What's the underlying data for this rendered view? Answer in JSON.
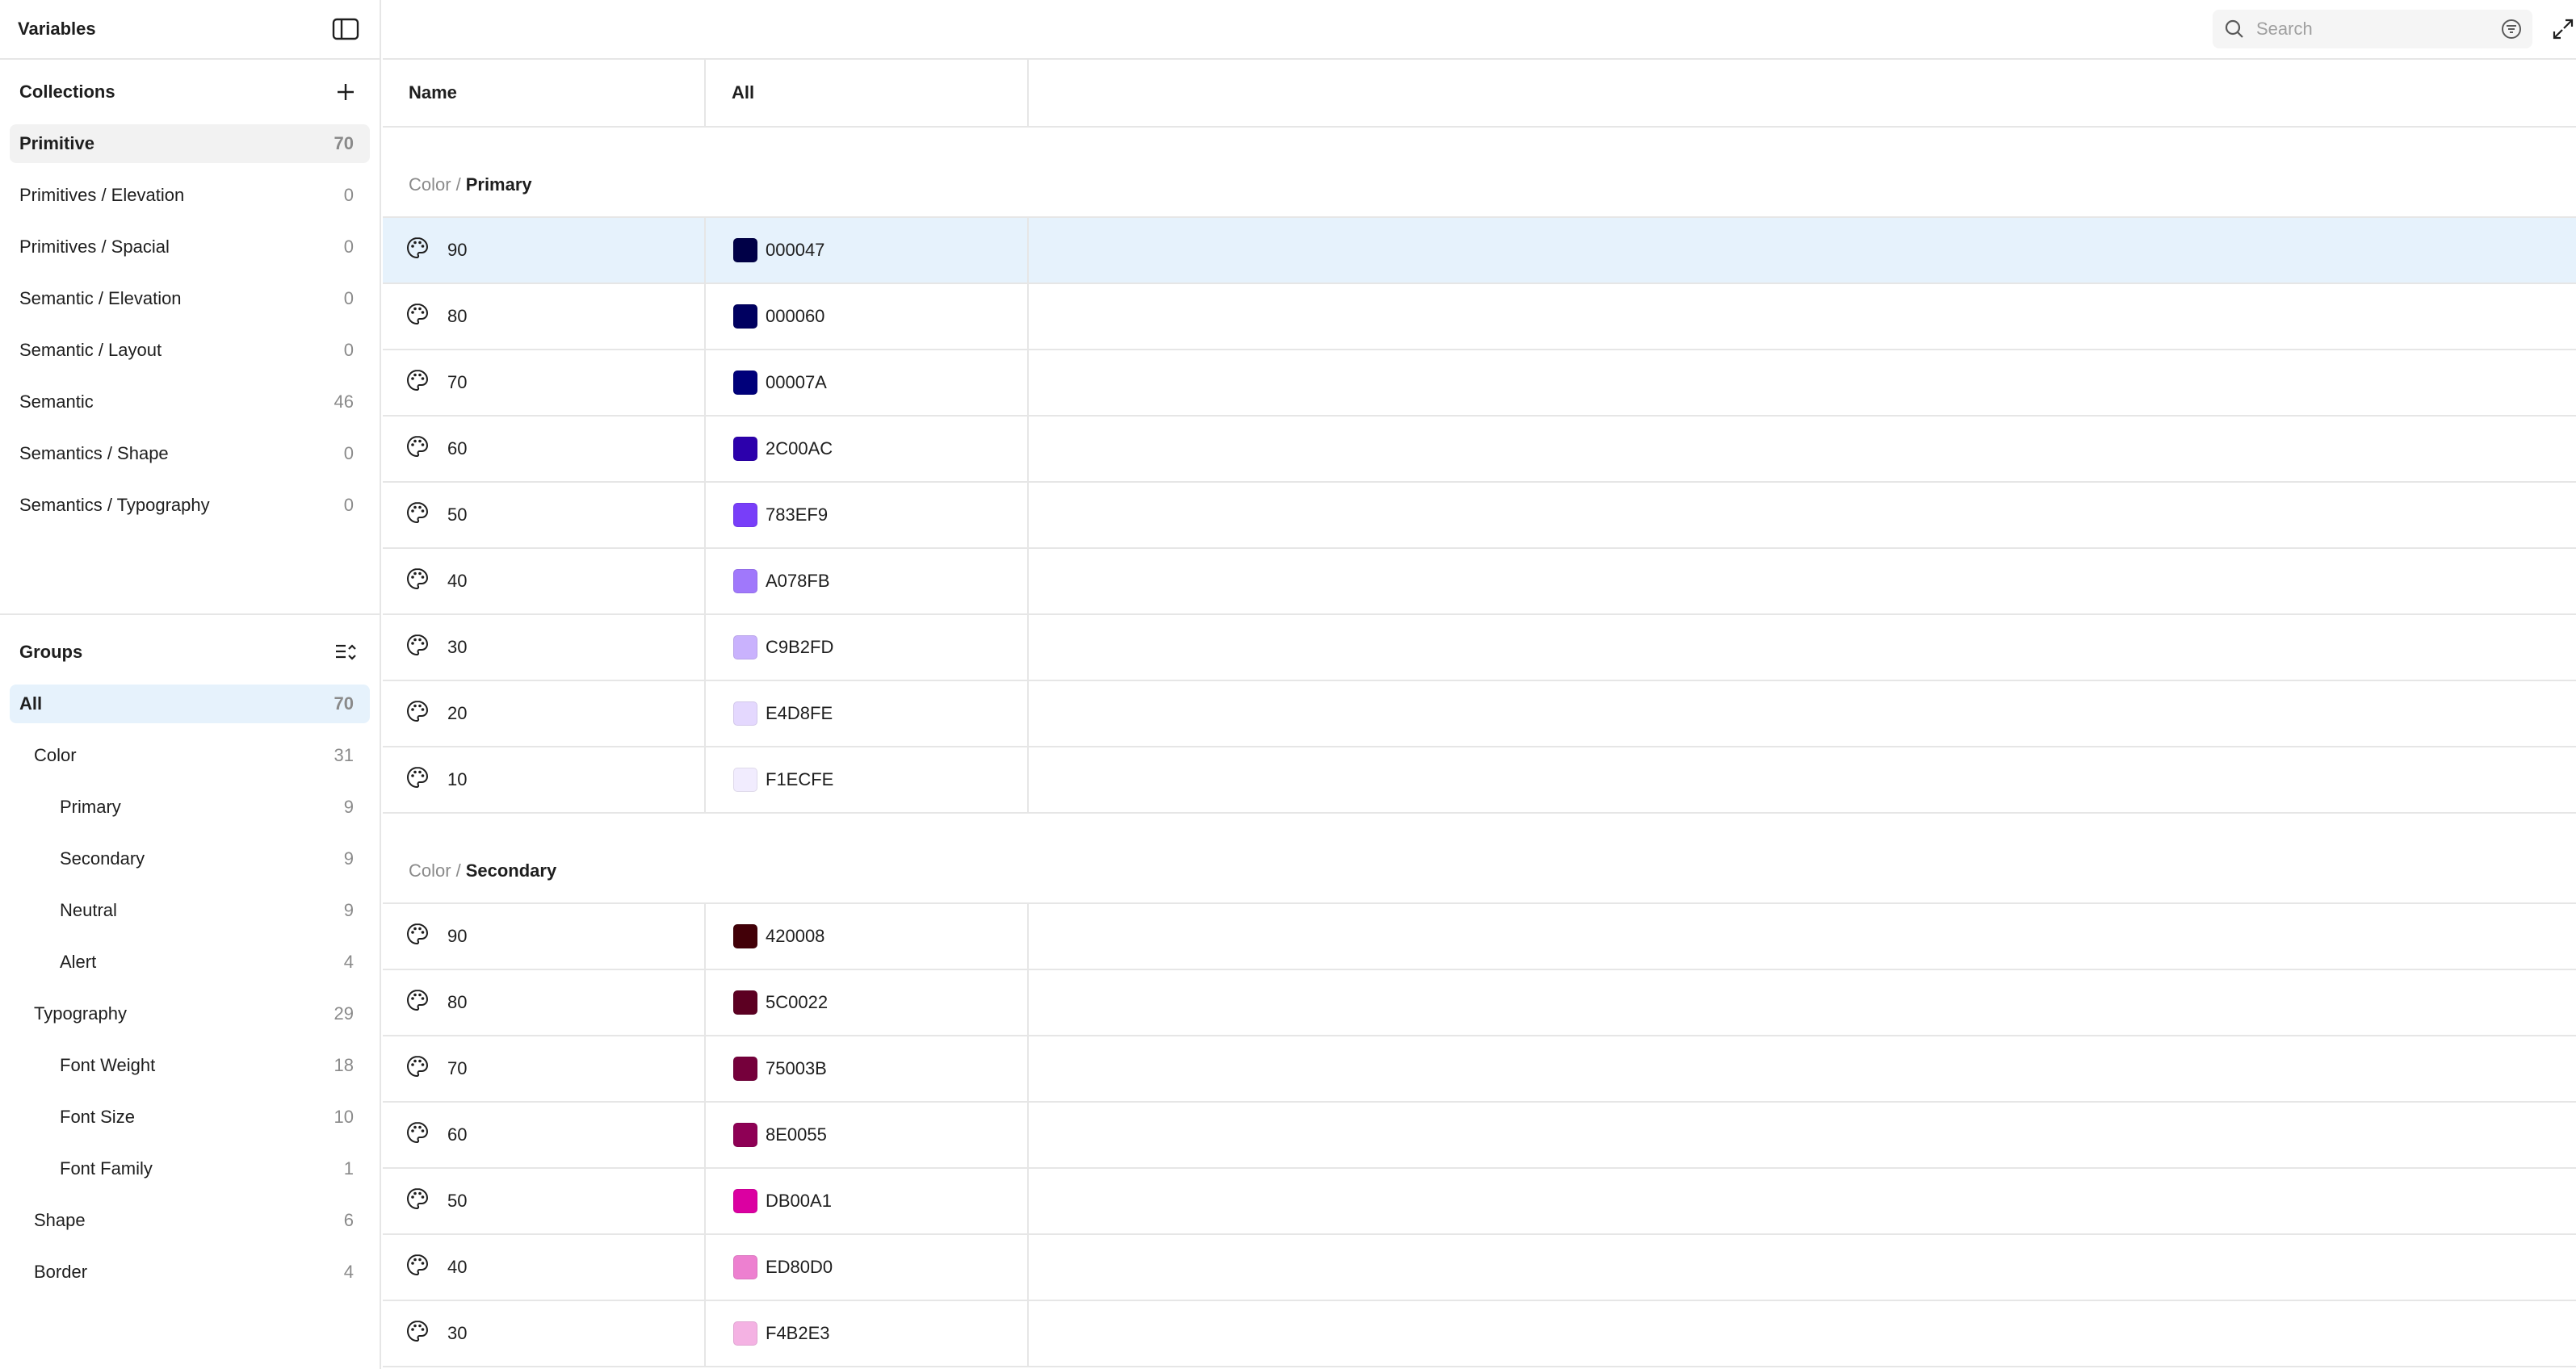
{
  "sidebar": {
    "title": "Variables",
    "collections_label": "Collections",
    "collections": [
      {
        "label": "Primitive",
        "count": "70"
      },
      {
        "label": "Primitives / Elevation",
        "count": "0"
      },
      {
        "label": "Primitives / Spacial",
        "count": "0"
      },
      {
        "label": "Semantic / Elevation",
        "count": "0"
      },
      {
        "label": "Semantic / Layout",
        "count": "0"
      },
      {
        "label": "Semantic",
        "count": "46"
      },
      {
        "label": "Semantics / Shape",
        "count": "0"
      },
      {
        "label": "Semantics / Typography",
        "count": "0"
      }
    ],
    "groups_label": "Groups",
    "groups": [
      {
        "label": "All",
        "count": "70"
      },
      {
        "label": "Color",
        "count": "31"
      },
      {
        "label": "Primary",
        "count": "9"
      },
      {
        "label": "Secondary",
        "count": "9"
      },
      {
        "label": "Neutral",
        "count": "9"
      },
      {
        "label": "Alert",
        "count": "4"
      },
      {
        "label": "Typography",
        "count": "29"
      },
      {
        "label": "Font Weight",
        "count": "18"
      },
      {
        "label": "Font Size",
        "count": "10"
      },
      {
        "label": "Font Family",
        "count": "1"
      },
      {
        "label": "Shape",
        "count": "6"
      },
      {
        "label": "Border",
        "count": "4"
      }
    ]
  },
  "search": {
    "placeholder": "Search"
  },
  "table": {
    "col_name": "Name",
    "col_mode": "All",
    "sections": [
      {
        "parent": "Color",
        "separator": "/",
        "name": "Primary",
        "rows": [
          {
            "name": "90",
            "value": "000047",
            "color": "#000047"
          },
          {
            "name": "80",
            "value": "000060",
            "color": "#000060"
          },
          {
            "name": "70",
            "value": "00007A",
            "color": "#00007A"
          },
          {
            "name": "60",
            "value": "2C00AC",
            "color": "#2C00AC"
          },
          {
            "name": "50",
            "value": "783EF9",
            "color": "#783EF9"
          },
          {
            "name": "40",
            "value": "A078FB",
            "color": "#A078FB"
          },
          {
            "name": "30",
            "value": "C9B2FD",
            "color": "#C9B2FD"
          },
          {
            "name": "20",
            "value": "E4D8FE",
            "color": "#E4D8FE"
          },
          {
            "name": "10",
            "value": "F1ECFE",
            "color": "#F1ECFE"
          }
        ]
      },
      {
        "parent": "Color",
        "separator": "/",
        "name": "Secondary",
        "rows": [
          {
            "name": "90",
            "value": "420008",
            "color": "#420008"
          },
          {
            "name": "80",
            "value": "5C0022",
            "color": "#5C0022"
          },
          {
            "name": "70",
            "value": "75003B",
            "color": "#75003B"
          },
          {
            "name": "60",
            "value": "8E0055",
            "color": "#8E0055"
          },
          {
            "name": "50",
            "value": "DB00A1",
            "color": "#DB00A1"
          },
          {
            "name": "40",
            "value": "ED80D0",
            "color": "#ED80D0"
          },
          {
            "name": "30",
            "value": "F4B2E3",
            "color": "#F4B2E3"
          }
        ]
      }
    ]
  },
  "theme": {
    "accent_bg": "#E6F2FC",
    "border": "#E6E6E6"
  }
}
